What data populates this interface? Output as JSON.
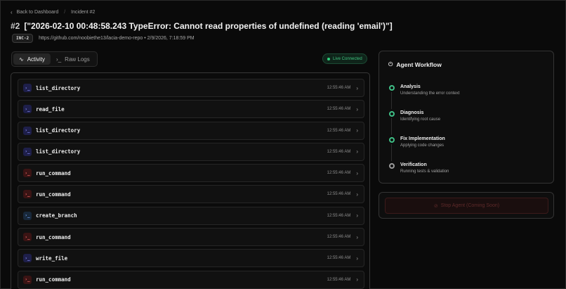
{
  "breadcrumb": {
    "back_label": "Back to Dashboard",
    "current": "Incident #2"
  },
  "incident": {
    "number": "#2",
    "title": "[\"2026-02-10 00:48:58.243 TypeError: Cannot read properties of undefined (reading 'email')\"]",
    "badge": "INC-2",
    "meta": "https://github.com/noobiethe13/lacia-demo-repo • 2/9/2026, 7:18:59 PM"
  },
  "tabs": [
    {
      "label": "Activity",
      "icon": "activity-icon",
      "active": true
    },
    {
      "label": "Raw Logs",
      "icon": "terminal-icon",
      "active": false
    }
  ],
  "status": {
    "label": "Live Connected",
    "color": "#3fc27e"
  },
  "activity": [
    {
      "name": "list_directory",
      "time": "12:55:46 AM",
      "kind": "blue"
    },
    {
      "name": "read_file",
      "time": "12:55:46 AM",
      "kind": "blue"
    },
    {
      "name": "list_directory",
      "time": "12:55:46 AM",
      "kind": "blue"
    },
    {
      "name": "list_directory",
      "time": "12:55:46 AM",
      "kind": "blue"
    },
    {
      "name": "run_command",
      "time": "12:55:46 AM",
      "kind": "red"
    },
    {
      "name": "run_command",
      "time": "12:55:46 AM",
      "kind": "red"
    },
    {
      "name": "create_branch",
      "time": "12:55:46 AM",
      "kind": "green"
    },
    {
      "name": "run_command",
      "time": "12:55:46 AM",
      "kind": "red"
    },
    {
      "name": "write_file",
      "time": "12:55:46 AM",
      "kind": "blue"
    },
    {
      "name": "run_command",
      "time": "12:55:46 AM",
      "kind": "red"
    }
  ],
  "workflow": {
    "title": "Agent Workflow",
    "steps": [
      {
        "title": "Analysis",
        "desc": "Understanding the error context",
        "state": "done"
      },
      {
        "title": "Diagnosis",
        "desc": "Identifying root cause",
        "state": "done"
      },
      {
        "title": "Fix Implementation",
        "desc": "Applying code changes",
        "state": "done"
      },
      {
        "title": "Verification",
        "desc": "Running tests & validation",
        "state": "pending"
      }
    ]
  },
  "stop_button": {
    "label": "Stop Agent (Coming Soon)"
  }
}
